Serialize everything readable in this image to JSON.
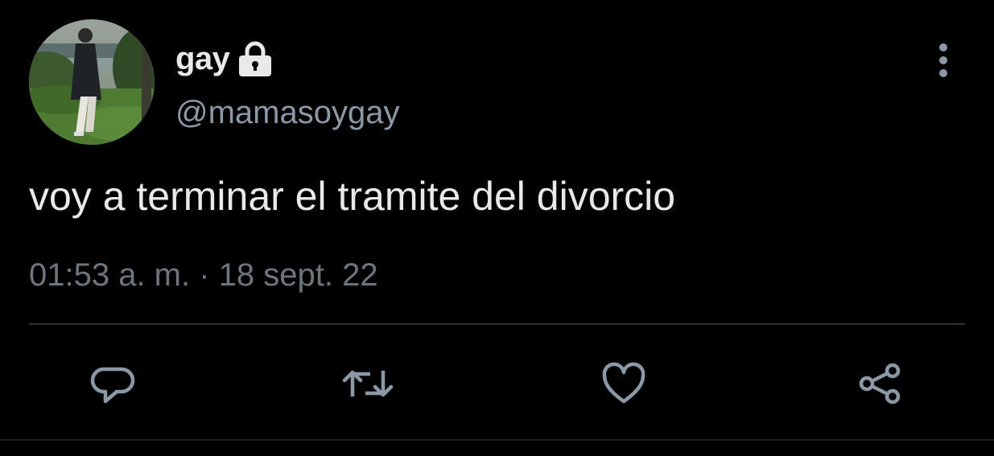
{
  "tweet": {
    "author": {
      "display_name": "gay",
      "handle": "@mamasoygay",
      "protected_icon": "lock-icon",
      "avatar_icon": "avatar-photo"
    },
    "text": "voy a terminar el tramite del divorcio",
    "timestamp": "01:53 a. m. · 18 sept. 22",
    "more_icon": "more-vertical-icon",
    "actions": [
      {
        "name": "reply",
        "icon": "reply-icon"
      },
      {
        "name": "retweet",
        "icon": "retweet-icon"
      },
      {
        "name": "like",
        "icon": "heart-icon"
      },
      {
        "name": "share",
        "icon": "share-icon"
      }
    ]
  },
  "colors": {
    "background": "#000000",
    "primary_text": "#e7e9ea",
    "secondary_text": "#8b98a5",
    "timestamp_text": "#6e767d",
    "icon": "#8b98a5",
    "divider": "#2f3336"
  }
}
